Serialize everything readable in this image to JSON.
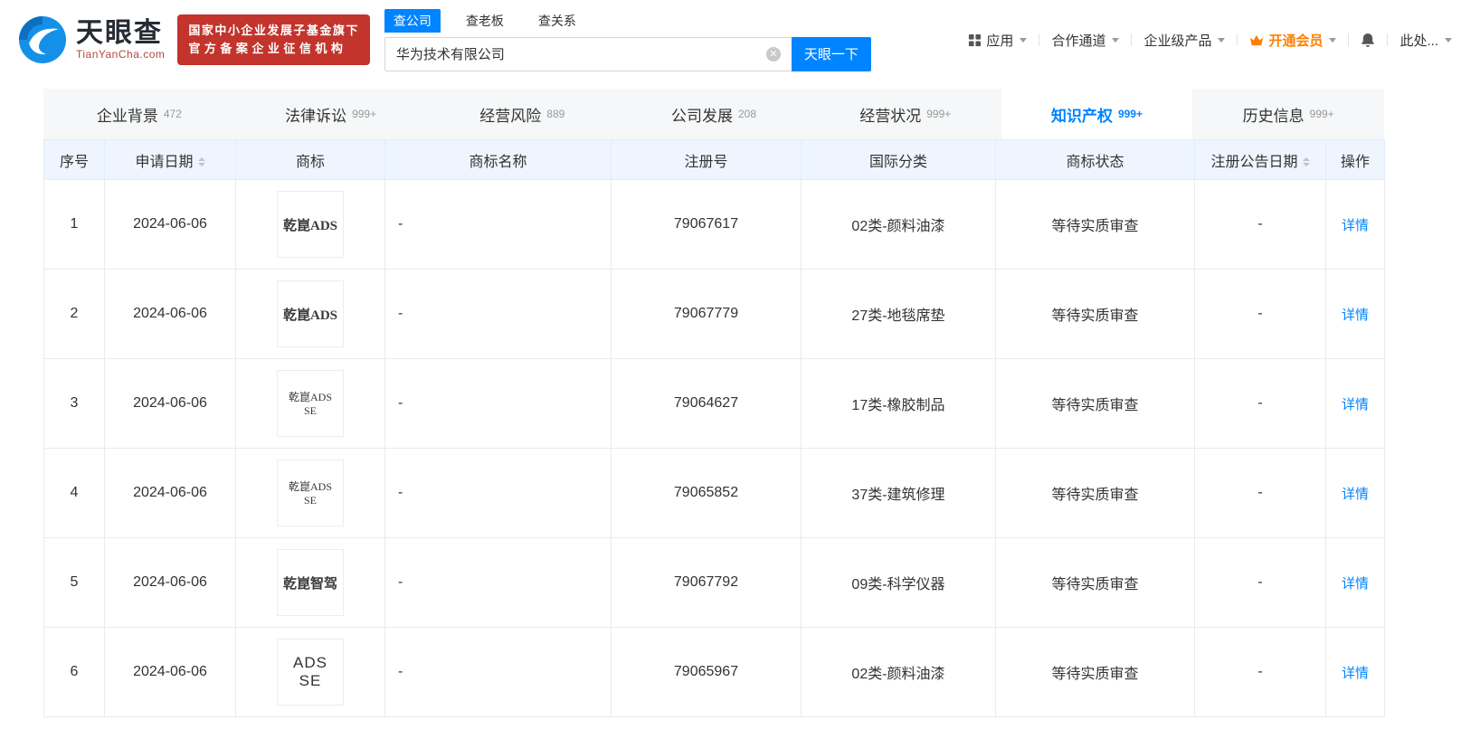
{
  "header": {
    "logo": {
      "name": "天眼查",
      "domain": "TianYanCha.com"
    },
    "badge": {
      "line1": "国家中小企业发展子基金旗下",
      "line2": "官方备案企业征信机构"
    },
    "search": {
      "tabs": [
        {
          "label": "查公司",
          "active": true
        },
        {
          "label": "查老板",
          "active": false
        },
        {
          "label": "查关系",
          "active": false
        }
      ],
      "value": "华为技术有限公司",
      "button": "天眼一下"
    },
    "nav": [
      {
        "name": "nav-item-apps",
        "label": "应用",
        "icon": "apps-grid-icon",
        "caret": true,
        "highlight": false
      },
      {
        "name": "nav-item-partner-channel",
        "label": "合作通道",
        "icon": "",
        "caret": true,
        "highlight": false
      },
      {
        "name": "nav-item-enterprise-products",
        "label": "企业级产品",
        "icon": "",
        "caret": true,
        "highlight": false
      },
      {
        "name": "nav-item-vip",
        "label": "开通会员",
        "icon": "crown-icon",
        "caret": true,
        "highlight": true
      },
      {
        "name": "nav-item-notifications",
        "label": "",
        "icon": "bell-icon",
        "caret": false,
        "highlight": false
      },
      {
        "name": "nav-item-account",
        "label": "此处...",
        "icon": "",
        "caret": true,
        "highlight": false
      }
    ]
  },
  "section_tabs": [
    {
      "label": "企业背景",
      "count": "472",
      "active": false
    },
    {
      "label": "法律诉讼",
      "count": "999+",
      "active": false
    },
    {
      "label": "经营风险",
      "count": "889",
      "active": false
    },
    {
      "label": "公司发展",
      "count": "208",
      "active": false
    },
    {
      "label": "经营状况",
      "count": "999+",
      "active": false
    },
    {
      "label": "知识产权",
      "count": "999+",
      "active": true
    },
    {
      "label": "历史信息",
      "count": "999+",
      "active": false
    }
  ],
  "table": {
    "columns": [
      {
        "label": "序号",
        "sortable": false
      },
      {
        "label": "申请日期",
        "sortable": true
      },
      {
        "label": "商标",
        "sortable": false
      },
      {
        "label": "商标名称",
        "sortable": false
      },
      {
        "label": "注册号",
        "sortable": false
      },
      {
        "label": "国际分类",
        "sortable": false
      },
      {
        "label": "商标状态",
        "sortable": false
      },
      {
        "label": "注册公告日期",
        "sortable": true
      },
      {
        "label": "操作",
        "sortable": false
      }
    ],
    "rows": [
      {
        "no": "1",
        "apply_date": "2024-06-06",
        "mark_text": "乾崑ADS",
        "mark_name": "-",
        "reg_no": "79067617",
        "intl_class": "02类-颜料油漆",
        "status": "等待实质审查",
        "pub_date": "-",
        "action": "详情"
      },
      {
        "no": "2",
        "apply_date": "2024-06-06",
        "mark_text": "乾崑ADS",
        "mark_name": "-",
        "reg_no": "79067779",
        "intl_class": "27类-地毯席垫",
        "status": "等待实质审查",
        "pub_date": "-",
        "action": "详情"
      },
      {
        "no": "3",
        "apply_date": "2024-06-06",
        "mark_text": "乾崑ADS SE",
        "mark_name": "-",
        "reg_no": "79064627",
        "intl_class": "17类-橡胶制品",
        "status": "等待实质审查",
        "pub_date": "-",
        "action": "详情"
      },
      {
        "no": "4",
        "apply_date": "2024-06-06",
        "mark_text": "乾崑ADS SE",
        "mark_name": "-",
        "reg_no": "79065852",
        "intl_class": "37类-建筑修理",
        "status": "等待实质审查",
        "pub_date": "-",
        "action": "详情"
      },
      {
        "no": "5",
        "apply_date": "2024-06-06",
        "mark_text": "乾崑智驾",
        "mark_name": "-",
        "reg_no": "79067792",
        "intl_class": "09类-科学仪器",
        "status": "等待实质审查",
        "pub_date": "-",
        "action": "详情"
      },
      {
        "no": "6",
        "apply_date": "2024-06-06",
        "mark_text": "ADS SE",
        "mark_name": "-",
        "reg_no": "79065967",
        "intl_class": "02类-颜料油漆",
        "status": "等待实质审查",
        "pub_date": "-",
        "action": "详情"
      }
    ]
  },
  "colors": {
    "brand_blue": "#0084ff",
    "badge_red": "#c2342c",
    "vip_orange": "#ff8000",
    "table_header_bg": "#eef5fe"
  }
}
